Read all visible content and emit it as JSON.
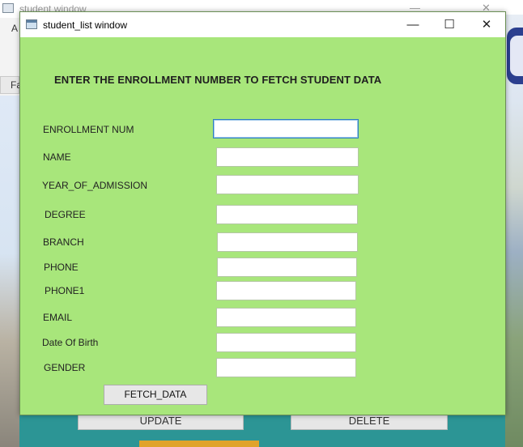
{
  "background_window": {
    "title": "student window",
    "menu_letter": "A",
    "tab_letter": "Fa",
    "update_label": "UPDATE",
    "delete_label": "DELETE"
  },
  "dialog": {
    "title": "student_list window",
    "minimize_glyph": "—",
    "maximize_glyph": "☐",
    "close_glyph": "✕",
    "heading": "ENTER THE ENROLLMENT NUMBER TO FETCH STUDENT DATA",
    "fields": {
      "enrollment": {
        "label": "ENROLLMENT NUM",
        "value": ""
      },
      "name": {
        "label": "NAME",
        "value": ""
      },
      "year": {
        "label": "YEAR_OF_ADMISSION",
        "value": ""
      },
      "degree": {
        "label": "DEGREE",
        "value": ""
      },
      "branch": {
        "label": "BRANCH",
        "value": ""
      },
      "phone": {
        "label": "PHONE",
        "value": ""
      },
      "phone1": {
        "label": "PHONE1",
        "value": ""
      },
      "email": {
        "label": "EMAIL",
        "value": ""
      },
      "dob": {
        "label": "Date Of Birth",
        "value": ""
      },
      "gender": {
        "label": "GENDER",
        "value": ""
      }
    },
    "fetch_label": "FETCH_DATA"
  },
  "colors": {
    "dialog_bg": "#a8e67b",
    "teal": "#2c9595",
    "focus_border": "#2f7fc1"
  }
}
